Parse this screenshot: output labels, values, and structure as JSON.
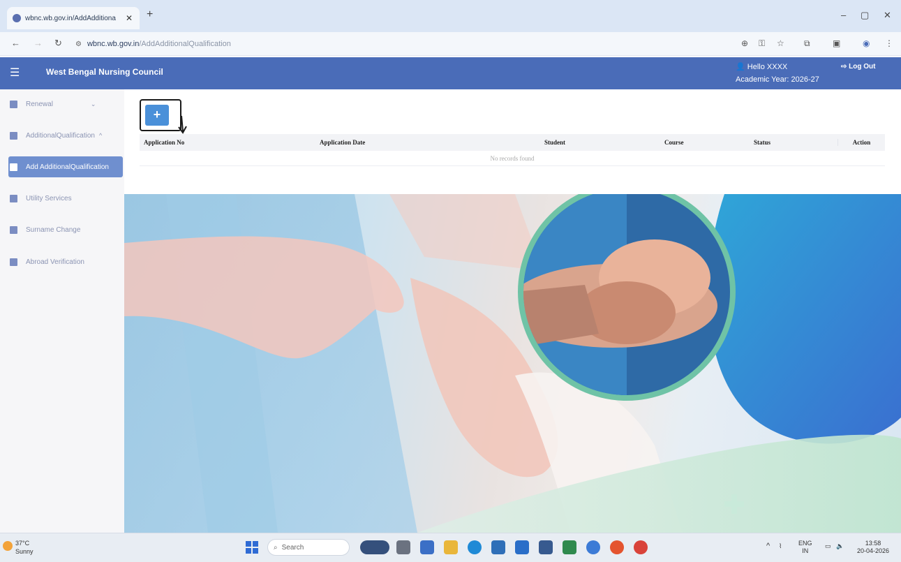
{
  "browser": {
    "tab_title": "wbnc.wb.gov.in/AddAdditiona",
    "tab_close": "✕",
    "new_tab": "+",
    "url_host": "wbnc.wb.gov.in",
    "url_path": "/AddAdditionalQualification",
    "window_controls": [
      "–",
      "▢",
      "✕"
    ]
  },
  "header": {
    "menu_icon": "☰",
    "app_name": "West Bengal Nursing Council",
    "user_greeting": "Hello XXXX",
    "academic_year": "Academic Year: 2026-27",
    "logout": "Log Out"
  },
  "sidebar": {
    "items": [
      {
        "label": "Renewal",
        "expand": "⌄"
      },
      {
        "label": "AdditionalQualification",
        "expand": "^"
      },
      {
        "label": "Add AdditionalQualification"
      },
      {
        "label": "Utility Services"
      },
      {
        "label": "Surname Change"
      },
      {
        "label": "Abroad Verification"
      }
    ]
  },
  "main": {
    "add_label": "+",
    "table": {
      "columns": [
        "Application No",
        "Application Date",
        "Student",
        "Course",
        "Status",
        "Action"
      ],
      "empty_text": "No records found"
    }
  },
  "taskbar": {
    "temperature": "37°C",
    "weather": "Sunny",
    "search_placeholder": "Search",
    "lang_top": "ENG",
    "lang_bottom": "IN",
    "time": "13:58",
    "date": "20-04-2026"
  },
  "colors": {
    "header_bg": "#4a6cb8",
    "sidebar_active_bg": "#6f8fcf",
    "add_button": "#4a90d9"
  }
}
